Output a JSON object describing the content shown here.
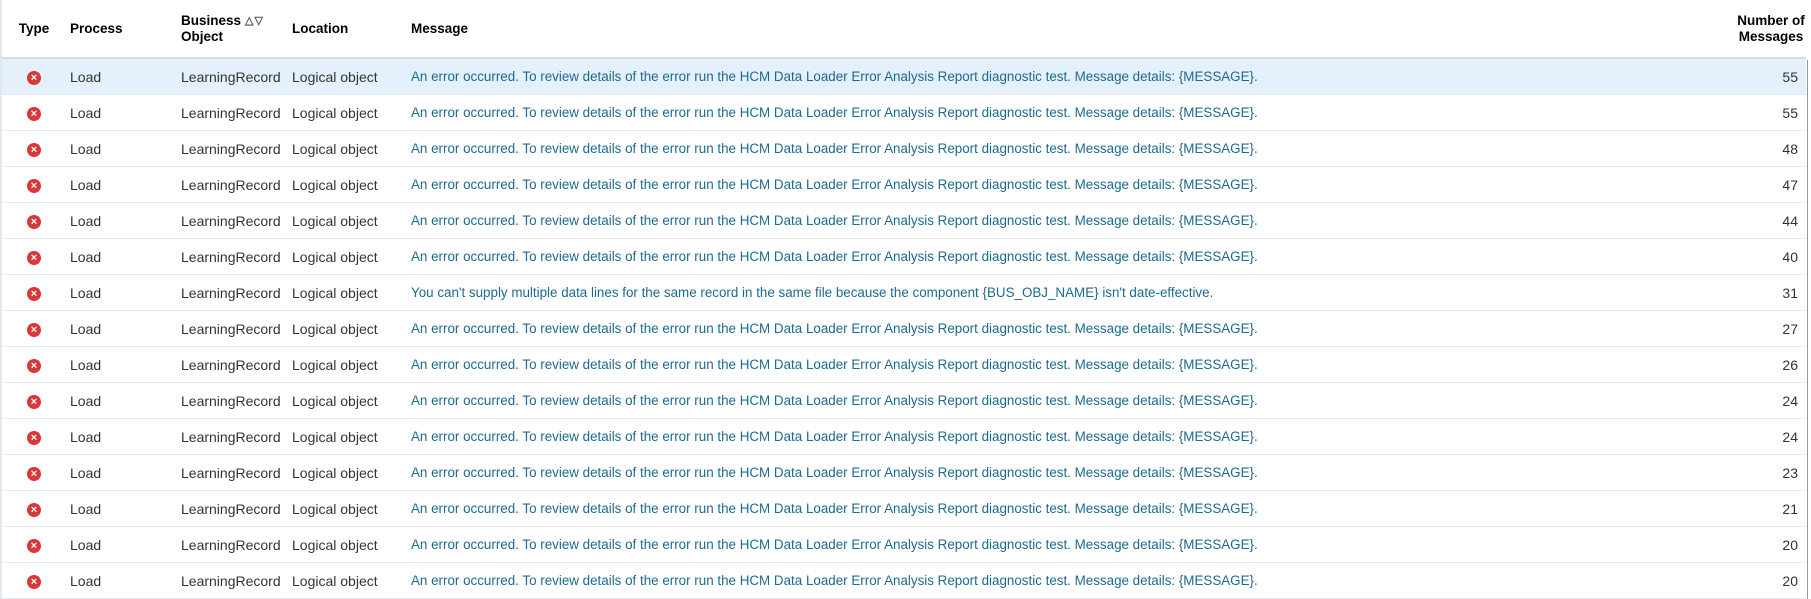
{
  "columns": {
    "type": "Type",
    "process": "Process",
    "business_object": "Business Object",
    "location": "Location",
    "message": "Message",
    "number": "Number of Messages"
  },
  "sort_icons": {
    "asc": "△",
    "desc": "▽"
  },
  "error_glyph": "×",
  "msg_a": "An error occurred. To review details of the error run the HCM Data Loader Error Analysis Report diagnostic test. Message details: {MESSAGE}.",
  "rows": [
    {
      "process": "Load",
      "bo": "LearningRecord",
      "location": "Logical object",
      "message": "An error occurred. To review details of the error run the HCM Data Loader Error Analysis Report diagnostic test. Message details: {MESSAGE}.",
      "count": "55"
    },
    {
      "process": "Load",
      "bo": "LearningRecord",
      "location": "Logical object",
      "message": "An error occurred. To review details of the error run the HCM Data Loader Error Analysis Report diagnostic test. Message details: {MESSAGE}.",
      "count": "55"
    },
    {
      "process": "Load",
      "bo": "LearningRecord",
      "location": "Logical object",
      "message": "An error occurred. To review details of the error run the HCM Data Loader Error Analysis Report diagnostic test. Message details: {MESSAGE}.",
      "count": "48"
    },
    {
      "process": "Load",
      "bo": "LearningRecord",
      "location": "Logical object",
      "message": "An error occurred. To review details of the error run the HCM Data Loader Error Analysis Report diagnostic test. Message details: {MESSAGE}.",
      "count": "47"
    },
    {
      "process": "Load",
      "bo": "LearningRecord",
      "location": "Logical object",
      "message": "An error occurred. To review details of the error run the HCM Data Loader Error Analysis Report diagnostic test. Message details: {MESSAGE}.",
      "count": "44"
    },
    {
      "process": "Load",
      "bo": "LearningRecord",
      "location": "Logical object",
      "message": "An error occurred. To review details of the error run the HCM Data Loader Error Analysis Report diagnostic test. Message details: {MESSAGE}.",
      "count": "40"
    },
    {
      "process": "Load",
      "bo": "LearningRecord",
      "location": "Logical object",
      "message": "You can't supply multiple data lines for the same record in the same file because the component {BUS_OBJ_NAME} isn't date-effective.",
      "count": "31"
    },
    {
      "process": "Load",
      "bo": "LearningRecord",
      "location": "Logical object",
      "message": "An error occurred. To review details of the error run the HCM Data Loader Error Analysis Report diagnostic test. Message details: {MESSAGE}.",
      "count": "27"
    },
    {
      "process": "Load",
      "bo": "LearningRecord",
      "location": "Logical object",
      "message": "An error occurred. To review details of the error run the HCM Data Loader Error Analysis Report diagnostic test. Message details: {MESSAGE}.",
      "count": "26"
    },
    {
      "process": "Load",
      "bo": "LearningRecord",
      "location": "Logical object",
      "message": "An error occurred. To review details of the error run the HCM Data Loader Error Analysis Report diagnostic test. Message details: {MESSAGE}.",
      "count": "24"
    },
    {
      "process": "Load",
      "bo": "LearningRecord",
      "location": "Logical object",
      "message": "An error occurred. To review details of the error run the HCM Data Loader Error Analysis Report diagnostic test. Message details: {MESSAGE}.",
      "count": "24"
    },
    {
      "process": "Load",
      "bo": "LearningRecord",
      "location": "Logical object",
      "message": "An error occurred. To review details of the error run the HCM Data Loader Error Analysis Report diagnostic test. Message details: {MESSAGE}.",
      "count": "23"
    },
    {
      "process": "Load",
      "bo": "LearningRecord",
      "location": "Logical object",
      "message": "An error occurred. To review details of the error run the HCM Data Loader Error Analysis Report diagnostic test. Message details: {MESSAGE}.",
      "count": "21"
    },
    {
      "process": "Load",
      "bo": "LearningRecord",
      "location": "Logical object",
      "message": "An error occurred. To review details of the error run the HCM Data Loader Error Analysis Report diagnostic test. Message details: {MESSAGE}.",
      "count": "20"
    },
    {
      "process": "Load",
      "bo": "LearningRecord",
      "location": "Logical object",
      "message": "An error occurred. To review details of the error run the HCM Data Loader Error Analysis Report diagnostic test. Message details: {MESSAGE}.",
      "count": "20"
    }
  ]
}
